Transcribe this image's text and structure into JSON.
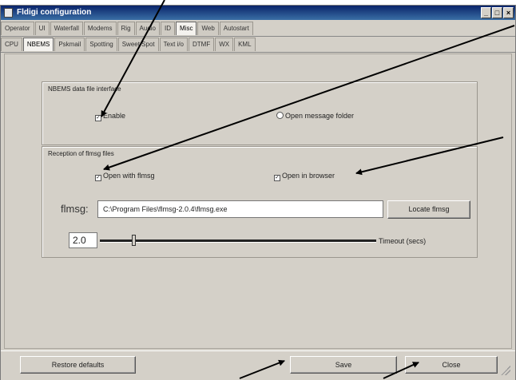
{
  "window": {
    "title": "Fldigi configuration",
    "controls": [
      "_",
      "□",
      "×"
    ]
  },
  "tabs_row1": [
    {
      "label": "Operator"
    },
    {
      "label": "UI"
    },
    {
      "label": "Waterfall"
    },
    {
      "label": "Modems"
    },
    {
      "label": "Rig"
    },
    {
      "label": "Audio"
    },
    {
      "label": "ID"
    },
    {
      "label": "Misc",
      "active": true
    },
    {
      "label": "Web"
    },
    {
      "label": "Autostart"
    }
  ],
  "tabs_row2": [
    {
      "label": "CPU"
    },
    {
      "label": "NBEMS",
      "active": true
    },
    {
      "label": "Pskmail"
    },
    {
      "label": "Spotting"
    },
    {
      "label": "Sweet Spot"
    },
    {
      "label": "Text i/o"
    },
    {
      "label": "DTMF"
    },
    {
      "label": "WX"
    },
    {
      "label": "KML"
    }
  ],
  "nbems_group": {
    "title": "NBEMS data file interface",
    "enable_label": "Enable",
    "enable_checked": true,
    "open_folder_label": "Open message folder"
  },
  "flmsg_group": {
    "title": "Reception of flmsg files",
    "open_with_label": "Open with flmsg",
    "open_with_checked": true,
    "open_browser_label": "Open in browser",
    "open_browser_checked": true,
    "flmsg_label": "flmsg:",
    "flmsg_path": "C:\\Program Files\\flmsg-2.0.4\\flmsg.exe",
    "locate_label": "Locate flmsg",
    "timeout_value": "2.0",
    "timeout_label": "Timeout (secs)",
    "timeout_fraction": 0.12
  },
  "bottom": {
    "restore_label": "Restore defaults",
    "save_label": "Save",
    "close_label": "Close"
  },
  "annotation_color": "#000000"
}
